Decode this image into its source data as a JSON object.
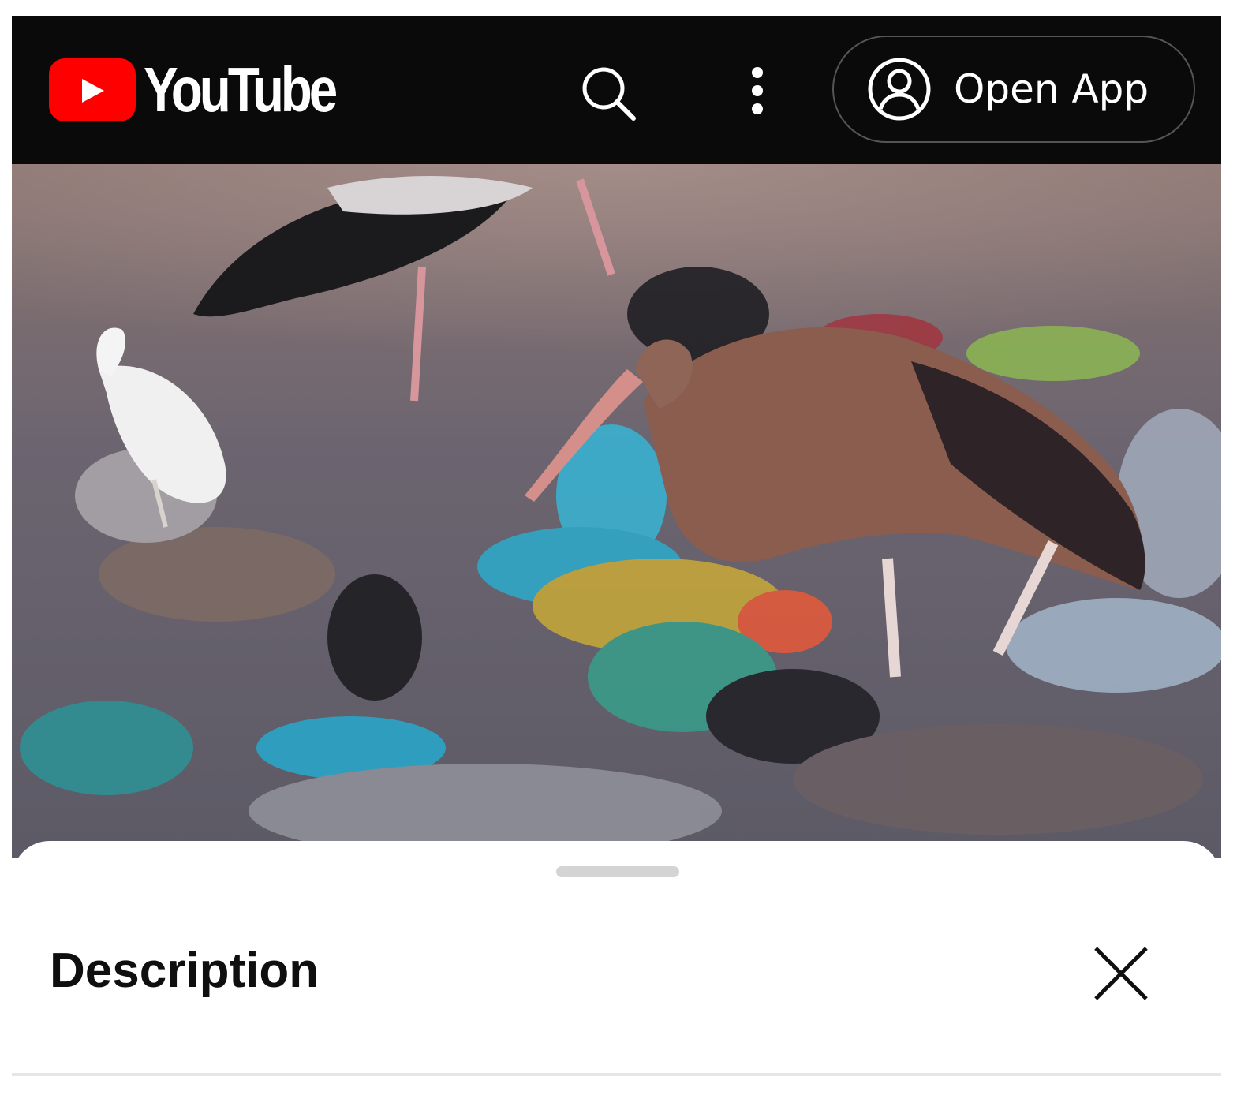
{
  "header": {
    "logo_text": "YouTube",
    "open_app_label": "Open App",
    "icons": {
      "logo": "youtube-play-icon",
      "search": "search-icon",
      "more": "more-vert-icon",
      "account": "account-circle-icon"
    }
  },
  "video": {
    "thumbnail": "storks-foraging-in-garbage-dump"
  },
  "description_sheet": {
    "title": "Description",
    "close_icon": "close-icon"
  },
  "colors": {
    "header_bg": "#0a0a0a",
    "brand_red": "#ff0000",
    "text_dark": "#0f0f0f",
    "sheet_bg": "#ffffff"
  }
}
